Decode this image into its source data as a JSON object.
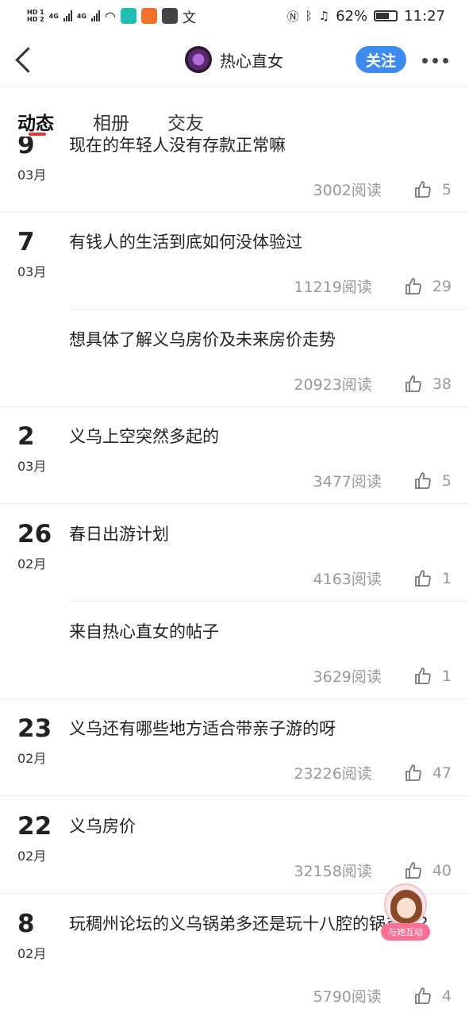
{
  "status_bar": {
    "battery": "62%",
    "time": "11:27",
    "network": [
      "HD 1",
      "HD 2",
      "4G",
      "4G"
    ]
  },
  "header": {
    "nickname": "热心直女",
    "follow_label": "关注"
  },
  "tabs": [
    {
      "label": "动态",
      "active": true
    },
    {
      "label": "相册",
      "active": false
    },
    {
      "label": "交友",
      "active": false
    }
  ],
  "posts": [
    {
      "day": "9",
      "month": "03月",
      "title": "现在的年轻人没有存款正常嘛",
      "reads": "3002阅读",
      "likes": "5"
    },
    {
      "day": "7",
      "month": "03月",
      "title": "有钱人的生活到底如何没体验过",
      "reads": "11219阅读",
      "likes": "29"
    },
    {
      "day": "",
      "month": "",
      "title": "想具体了解义乌房价及未来房价走势",
      "reads": "20923阅读",
      "likes": "38"
    },
    {
      "day": "2",
      "month": "03月",
      "title": "义乌上空突然多起的",
      "reads": "3477阅读",
      "likes": "5"
    },
    {
      "day": "26",
      "month": "02月",
      "title": "春日出游计划",
      "reads": "4163阅读",
      "likes": "1"
    },
    {
      "day": "",
      "month": "",
      "title": "来自热心直女的帖子",
      "reads": "3629阅读",
      "likes": "1"
    },
    {
      "day": "23",
      "month": "02月",
      "title": "义乌还有哪些地方适合带亲子游的呀",
      "reads": "23226阅读",
      "likes": "47"
    },
    {
      "day": "22",
      "month": "02月",
      "title": "义乌房价",
      "reads": "32158阅读",
      "likes": "40"
    },
    {
      "day": "8",
      "month": "02月",
      "title": "玩稠州论坛的义乌锅弟多还是玩十八腔的锅弟多？",
      "reads": "5790阅读",
      "likes": "4"
    }
  ],
  "floating_button": {
    "label": "与她互动"
  },
  "colors": {
    "accent": "#3d8bf2",
    "tab_indicator": "#e23b3b",
    "float_label_bg": "#ff6f96"
  }
}
